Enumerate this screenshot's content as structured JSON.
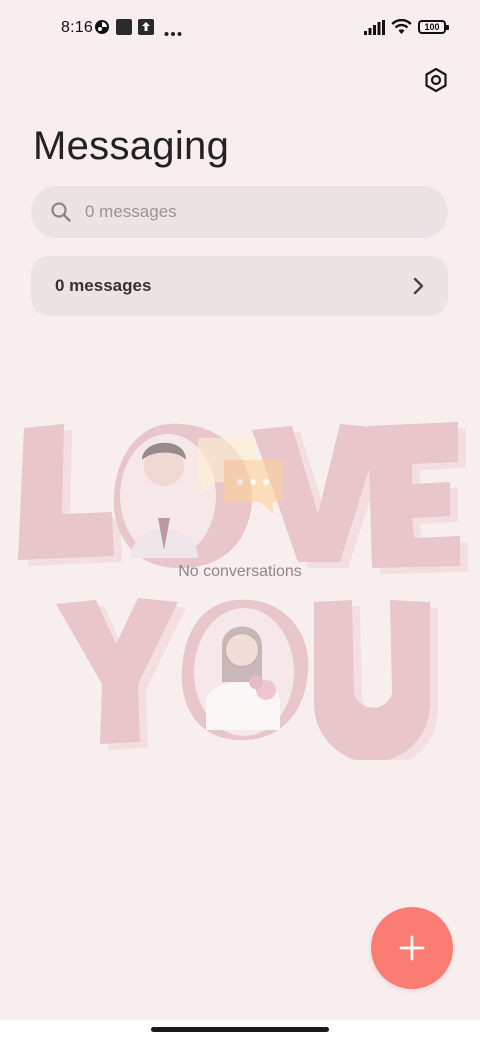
{
  "status_bar": {
    "time": "8:16",
    "battery": "100",
    "icons": [
      "notification-app-icon",
      "square-app-icon",
      "upload-icon",
      "more-dots-icon",
      "signal-icon",
      "wifi-icon",
      "battery-icon"
    ]
  },
  "header": {
    "title": "Messaging",
    "settings_icon": "settings-hexagon-icon"
  },
  "search": {
    "placeholder": "0 messages",
    "icon": "search-icon"
  },
  "messages_row": {
    "label": "0 messages",
    "icon": "chevron-right-icon"
  },
  "empty_state": {
    "text": "No conversations",
    "illustration": "love-you-couple-illustration"
  },
  "fab": {
    "icon": "plus-icon",
    "color": "#fb7c72"
  },
  "colors": {
    "background": "#f8eeee",
    "field": "#ece4e4",
    "accent": "#fb7c72"
  }
}
